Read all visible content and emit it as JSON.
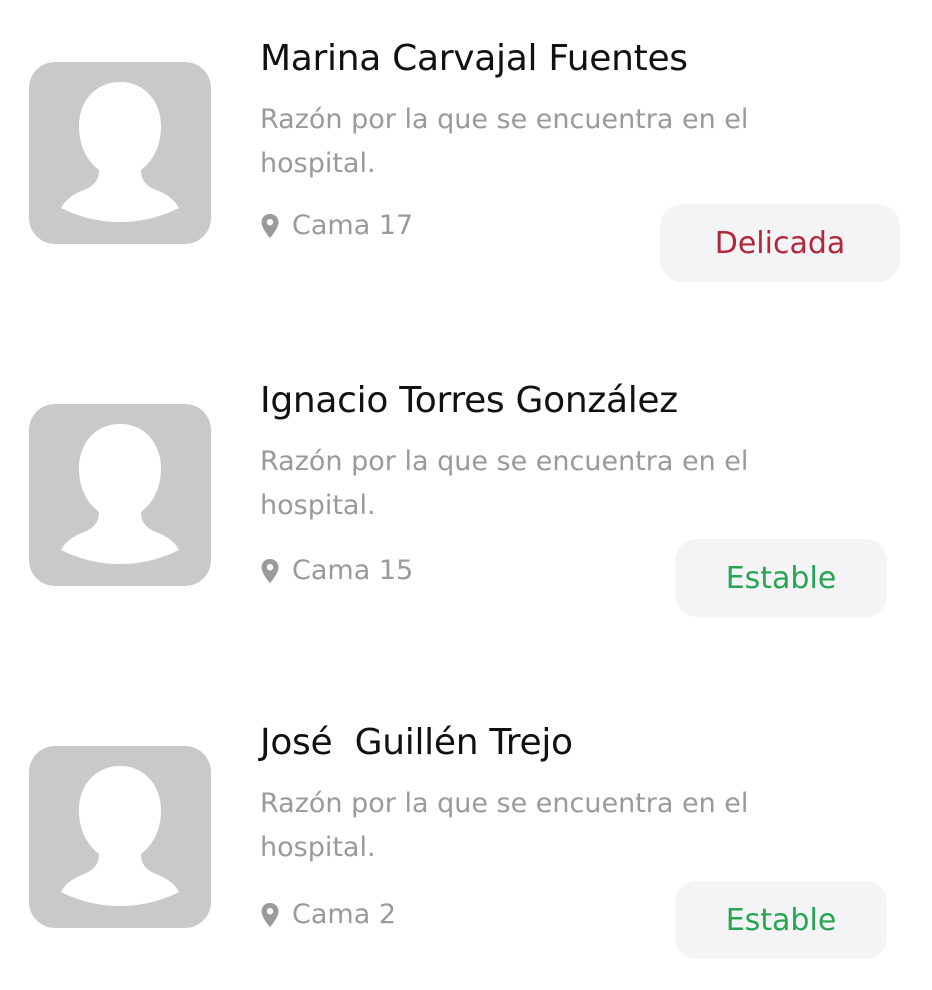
{
  "colors": {
    "avatar_bg": "#c9c9c9",
    "status_bg": "#f4f4f6",
    "critical": "#b3273a",
    "stable": "#27a552",
    "secondary_text": "#9a9a9e"
  },
  "patients": [
    {
      "name": "Marina Carvajal Fuentes",
      "reason": "Razón por la que se encuentra en el hospital.",
      "bed": "Cama 17",
      "status": "Delicada",
      "status_type": "critical",
      "avatar_icon": "person-placeholder-icon",
      "location_icon": "location-pin-icon"
    },
    {
      "name": "Ignacio Torres González",
      "reason": "Razón por la que se encuentra en el hospital.",
      "bed": "Cama 15",
      "status": "Estable",
      "status_type": "stable",
      "avatar_icon": "person-placeholder-icon",
      "location_icon": "location-pin-icon"
    },
    {
      "name": "José  Guillén Trejo",
      "reason": "Razón por la que se encuentra en el hospital.",
      "bed": "Cama 2",
      "status": "Estable",
      "status_type": "stable",
      "avatar_icon": "person-placeholder-icon",
      "location_icon": "location-pin-icon"
    }
  ]
}
